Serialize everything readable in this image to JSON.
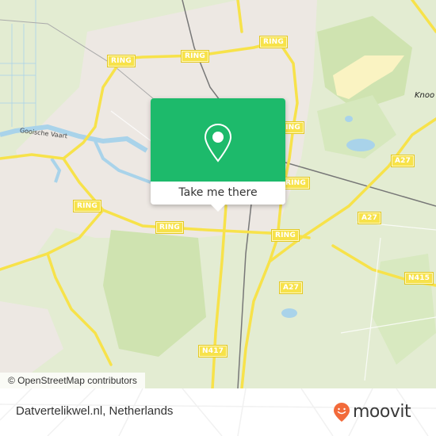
{
  "map": {
    "road_labels": [
      {
        "text": "RING"
      },
      {
        "text": "RING"
      },
      {
        "text": "RING"
      },
      {
        "text": "RING"
      },
      {
        "text": "RING"
      },
      {
        "text": "RING"
      },
      {
        "text": "RING"
      },
      {
        "text": "RING"
      },
      {
        "text": "RING"
      },
      {
        "text": "A27"
      },
      {
        "text": "A27"
      },
      {
        "text": "A27"
      },
      {
        "text": "N415"
      },
      {
        "text": "N417"
      }
    ],
    "place_labels": {
      "waterway": "Gooische Vaart",
      "town": "Knoo"
    },
    "colors": {
      "land": "#e3ecd2",
      "urban": "#ede8e3",
      "forest": "#cfe3b0",
      "water": "#a9d3ea",
      "road": "#f7e24a",
      "heath": "#faf3c2"
    }
  },
  "popup": {
    "icon": "map-pin-icon",
    "cta_label": "Take me there",
    "accent_color": "#1dba6b"
  },
  "attribution": {
    "text": "© OpenStreetMap contributors"
  },
  "footer": {
    "place_name": "Datvertelikwel.nl, Netherlands",
    "brand": {
      "name": "moovit",
      "icon": "moovit-logo-icon",
      "color": "#f26a3a"
    }
  }
}
